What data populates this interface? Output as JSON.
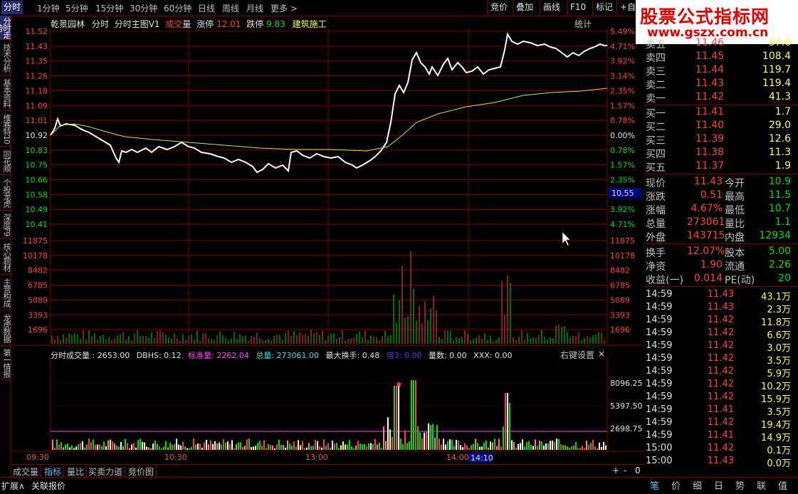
{
  "periods": [
    "分时",
    "1分钟",
    "5分钟",
    "15分钟",
    "30分钟",
    "60分钟",
    "日线",
    "周线",
    "月线",
    "更多 >"
  ],
  "right_buttons": [
    "竞价",
    "叠加",
    "画线",
    "F10",
    "标记",
    "+自选"
  ],
  "logo": {
    "title": "股票公式指标网",
    "url": "www.gszx.com.cn"
  },
  "side_tabs": [
    "分时走势",
    "技术分析",
    "基本资料",
    "维赛特10",
    "同花顺",
    "个股龙虎",
    "深度F9",
    "核心题材",
    "主营构成",
    "龙虎数据",
    "第一情报"
  ],
  "info": {
    "stock": "乾景园林",
    "mode": "分时",
    "indicator": "分时主图V1",
    "vol_label1": "成交",
    "vol_label2": "量",
    "zt_label": "涨停",
    "zt_value": "12.01",
    "dt_label": "跌停",
    "dt_value": "9.83",
    "sector": "建筑施工",
    "stats_label": "统计"
  },
  "price_axis": {
    "left": [
      "11.52",
      "11.43",
      "11.35",
      "11.26",
      "11.18",
      "11.09",
      "11.01",
      "10.92",
      "10.83",
      "10.75",
      "10.66",
      "10.58",
      "10.49",
      "10.41"
    ],
    "right": [
      "5.49%",
      "4.71%",
      "3.92%",
      "3.14%",
      "2.35%",
      "1.57%",
      "0.78%",
      "0.00%",
      "0.78%",
      "1.57%",
      "2.35%",
      "3.14%",
      "3.92%",
      "4.71%"
    ],
    "price_tag": "10.55"
  },
  "volume_axis": {
    "labels": [
      "11875",
      "10178",
      "8482",
      "6785",
      "5089",
      "3393",
      "1696"
    ]
  },
  "indicator": {
    "label": "分时成交量 : 2653.00",
    "dbhs": "DBHS: 0.12",
    "bzl": "标准量: 2262.04",
    "zl": "总量: 273061.00",
    "zdhs": "最大换手: 0.48",
    "zb": "倍3: 0.00",
    "ls": "量数: 0.00",
    "xxx": "XXX: 0.00",
    "settings": "右键设置",
    "close": "×",
    "axis": [
      "8096.25",
      "5397.50",
      "2698.75"
    ]
  },
  "time_axis": {
    "labels": [
      "09:30",
      "10:30",
      "13:00",
      "14:00"
    ],
    "cursor": "14:10"
  },
  "bottom_tabs": [
    "成交量",
    "指标",
    "量比",
    "买卖力道",
    "竞价图"
  ],
  "bottom_controls": [
    "+",
    "-",
    "0"
  ],
  "status": {
    "expand": "扩展∧",
    "related": "关联报价"
  },
  "right_bottom_tabs": [
    "笔",
    "价",
    "细",
    "日",
    "势",
    "联",
    "值"
  ],
  "orderbook": {
    "sell": [
      {
        "label": "卖五",
        "price": "11.46",
        "vol": "37.6"
      },
      {
        "label": "卖四",
        "price": "11.45",
        "vol": "108.4"
      },
      {
        "label": "卖三",
        "price": "11.44",
        "vol": "119.7"
      },
      {
        "label": "卖二",
        "price": "11.43",
        "vol": "119.4"
      },
      {
        "label": "卖一",
        "price": "11.42",
        "vol": "41.3"
      }
    ],
    "buy": [
      {
        "label": "买一",
        "price": "11.41",
        "vol": "1.7"
      },
      {
        "label": "买二",
        "price": "11.40",
        "vol": "29.0"
      },
      {
        "label": "买三",
        "price": "11.39",
        "vol": "12.6"
      },
      {
        "label": "买四",
        "price": "11.38",
        "vol": "11.3"
      },
      {
        "label": "买五",
        "price": "11.37",
        "vol": "1.9"
      }
    ]
  },
  "quote": [
    {
      "l1": "现价",
      "v1": "11.43",
      "l2": "今开",
      "v2": "10.9"
    },
    {
      "l1": "涨跌",
      "v1": "0.51",
      "l2": "最高",
      "v2": "11.5"
    },
    {
      "l1": "涨幅",
      "v1": "4.67%",
      "l2": "最低",
      "v2": "10.7"
    },
    {
      "l1": "总量",
      "v1": "273061",
      "l2": "量比",
      "v2": "1.1"
    },
    {
      "l1": "外盘",
      "v1": "143715",
      "l2": "内盘",
      "v2": "12934"
    }
  ],
  "fundamentals": [
    {
      "l1": "换手",
      "v1": "12.07%",
      "l2": "股本",
      "v2": "5.00"
    },
    {
      "l1": "净资",
      "v1": "1.90",
      "l2": "流通",
      "v2": "2.26"
    },
    {
      "l1": "收益(一)",
      "v1": "0.014",
      "l2": "PE(动)",
      "v2": "20"
    }
  ],
  "trades": [
    {
      "t": "14:59",
      "p": "11.43",
      "v": "43.1万",
      "c": "#ff4040"
    },
    {
      "t": "14:59",
      "p": "11.43",
      "v": "2.3万",
      "c": "#ff4040"
    },
    {
      "t": "14:59",
      "p": "11.42",
      "v": "11.8万",
      "c": "#ff4040"
    },
    {
      "t": "14:59",
      "p": "11.42",
      "v": "6.6万",
      "c": "#ff4040"
    },
    {
      "t": "14:59",
      "p": "11.42",
      "v": "3.0万",
      "c": "#ff4040"
    },
    {
      "t": "14:59",
      "p": "11.42",
      "v": "3.5万",
      "c": "#ff4040"
    },
    {
      "t": "14:59",
      "p": "11.42",
      "v": "5.9万",
      "c": "#ff4040"
    },
    {
      "t": "14:59",
      "p": "11.42",
      "v": "10.2万",
      "c": "#ff4040"
    },
    {
      "t": "14:59",
      "p": "11.42",
      "v": "15.9万",
      "c": "#ff4040"
    },
    {
      "t": "14:59",
      "p": "11.41",
      "v": "3.5万",
      "c": "#ff4040"
    },
    {
      "t": "14:59",
      "p": "11.42",
      "v": "19.4万",
      "c": "#ff4040"
    },
    {
      "t": "14:59",
      "p": "11.41",
      "v": "14.9万",
      "c": "#ff4040"
    },
    {
      "t": "15:00",
      "p": "11.42",
      "v": "0.1万",
      "c": "#ff4040"
    },
    {
      "t": "15:00",
      "p": "11.43",
      "v": "0.0万",
      "c": "#ff4040"
    }
  ],
  "colors": {
    "up": "#ff4040",
    "down": "#00e000",
    "grid": "#800000",
    "price_line": "#ffffff",
    "avg_line": "#e0e040",
    "magenta": "#ff40ff"
  }
}
